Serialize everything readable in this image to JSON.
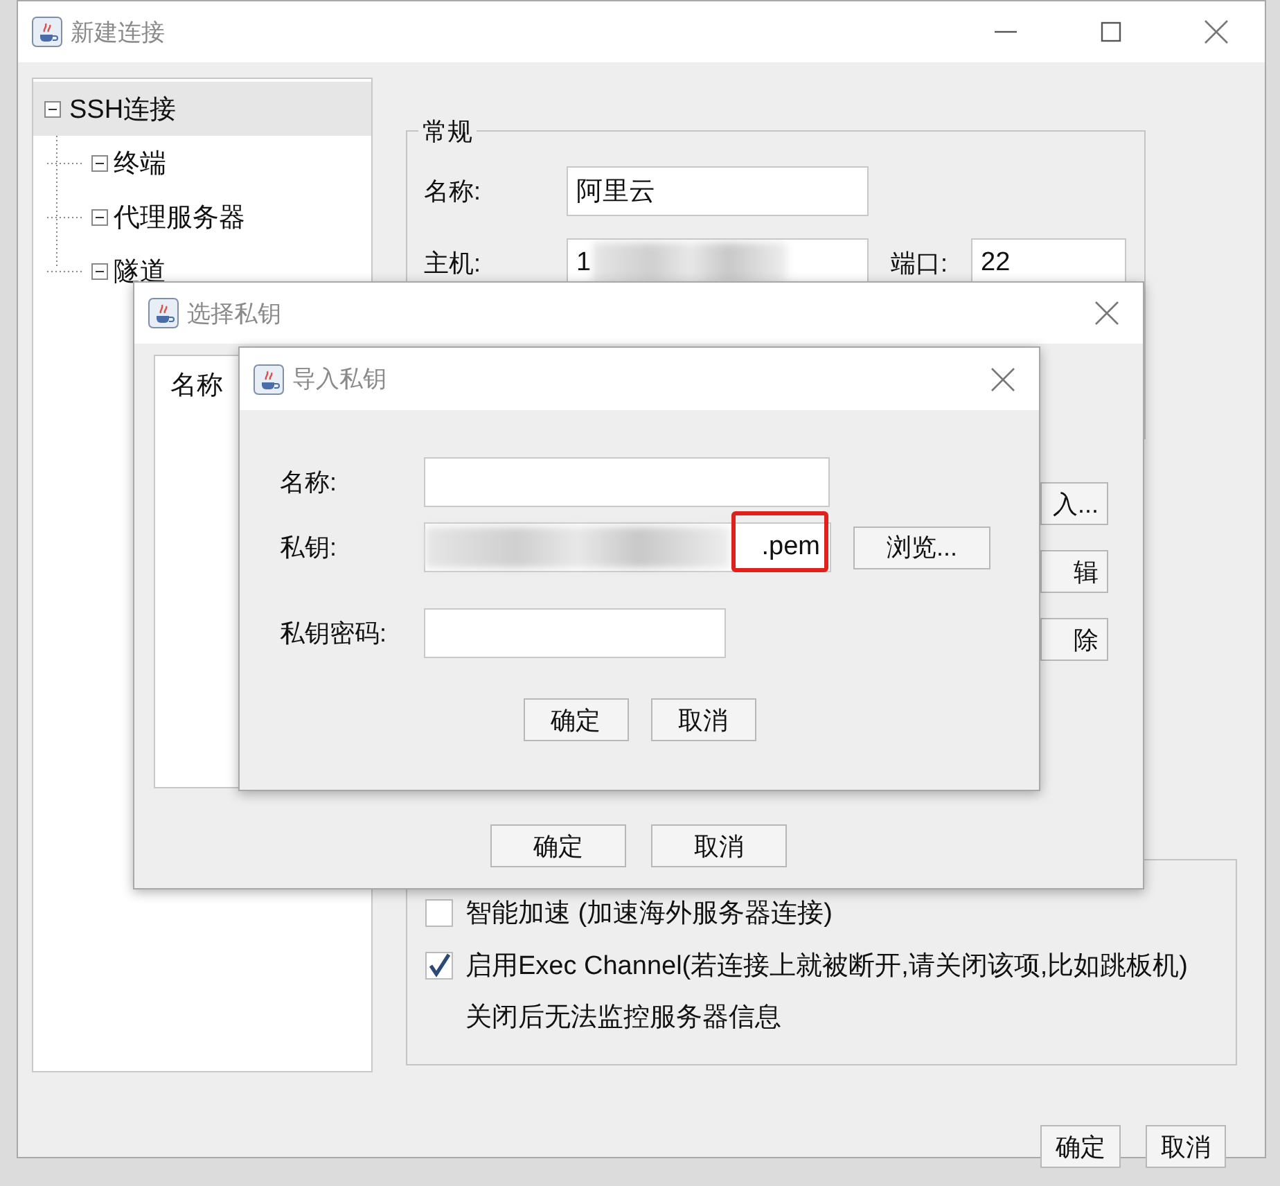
{
  "main_window": {
    "title": "新建连接",
    "tree": [
      {
        "label": "SSH连接",
        "selected": true,
        "expanded": true,
        "children": [
          {
            "label": "终端",
            "selected": false,
            "expanded": true
          },
          {
            "label": "代理服务器",
            "selected": false,
            "expanded": true
          },
          {
            "label": "隧道",
            "selected": false,
            "expanded": true
          }
        ]
      }
    ],
    "general": {
      "legend": "常规",
      "fields": [
        {
          "label": "名称:",
          "value": "阿里云"
        },
        {
          "label": "主机:",
          "value": "1",
          "redacted": true
        },
        {
          "label": "端口:",
          "value": "22"
        }
      ]
    },
    "options": [
      {
        "label": "智能加速 (加速海外服务器连接)",
        "checked": false
      },
      {
        "label": "启用Exec Channel(若连接上就被断开,请关闭该项,比如跳板机)",
        "checked": true
      }
    ],
    "note": "关闭后无法监控服务器信息",
    "buttons": [
      "确定",
      "取消"
    ]
  },
  "select_key_dialog": {
    "title": "选择私钥",
    "list_header": "名称",
    "side_buttons": [
      "入...",
      "辑",
      "除"
    ],
    "buttons": [
      "确定",
      "取消"
    ]
  },
  "import_key_dialog": {
    "title": "导入私钥",
    "fields": [
      {
        "label": "名称:",
        "kind": "text"
      },
      {
        "label": "私钥:",
        "kind": "file",
        "value": ".pem",
        "redacted": true,
        "highlighted": true,
        "button": "浏览..."
      },
      {
        "label": "私钥密码:",
        "kind": "password"
      }
    ],
    "buttons": [
      "确定",
      "取消"
    ]
  }
}
